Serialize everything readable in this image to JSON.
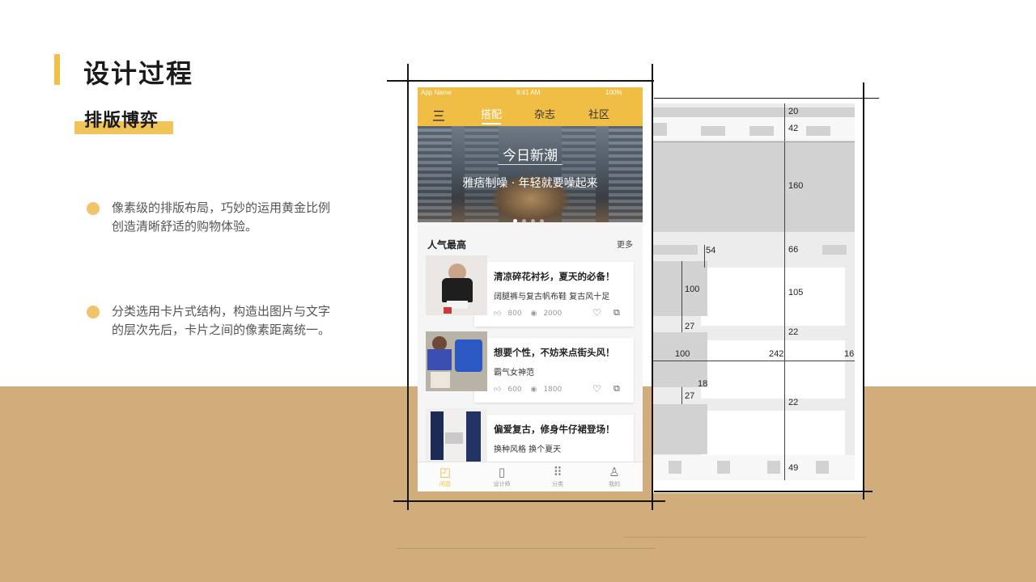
{
  "slide": {
    "title": "设计过程",
    "subtitle": "排版博弈",
    "bullets": [
      {
        "line1": "像素级的排版布局，巧妙的运用黄金比例",
        "line2": "创造清晰舒适的购物体验。"
      },
      {
        "line1": "分类选用卡片式结构，构造出图片与文字",
        "line2": "的层次先后，卡片之间的像素距离统一。"
      }
    ]
  },
  "phone": {
    "status": {
      "app": "App Name",
      "time": "9:41 AM",
      "battery": "100%"
    },
    "nav": {
      "menu_icon": "三",
      "tabs": [
        "搭配",
        "杂志",
        "社区"
      ],
      "active": 0
    },
    "banner": {
      "title": "今日新潮",
      "subtitle": "雅痞制噪 · 年轻就要噪起来",
      "dots": 4,
      "active_dot": 0
    },
    "section": {
      "title": "人气最高",
      "more": "更多"
    },
    "cards": [
      {
        "title": "清凉碎花衬衫，夏天的必备！",
        "tags": "阔腿裤与复古帆布鞋  复古风十足",
        "likes": "800",
        "views": "2000"
      },
      {
        "title": "想要个性，不妨来点街头风！",
        "tags": "霸气女神范",
        "likes": "600",
        "views": "1800"
      },
      {
        "title": "偏爱复古，修身牛仔裙登场！",
        "tags": "换种风格  换个夏天",
        "likes": "",
        "views": ""
      }
    ],
    "tabbar": [
      {
        "label": "闲逛",
        "icon": "bag-icon"
      },
      {
        "label": "设计师",
        "icon": "phone-icon"
      },
      {
        "label": "分类",
        "icon": "grid-icon"
      },
      {
        "label": "我的",
        "icon": "user-icon"
      }
    ],
    "active_tab": 0
  },
  "spec": {
    "dims": [
      "20",
      "42",
      "160",
      "54",
      "66",
      "100",
      "105",
      "27",
      "22",
      "100",
      "242",
      "16",
      "18",
      "27",
      "22",
      "49"
    ]
  },
  "colors": {
    "accent": "#f0bd45",
    "floor": "#d1ad7c",
    "bullet": "#f1c36a"
  }
}
